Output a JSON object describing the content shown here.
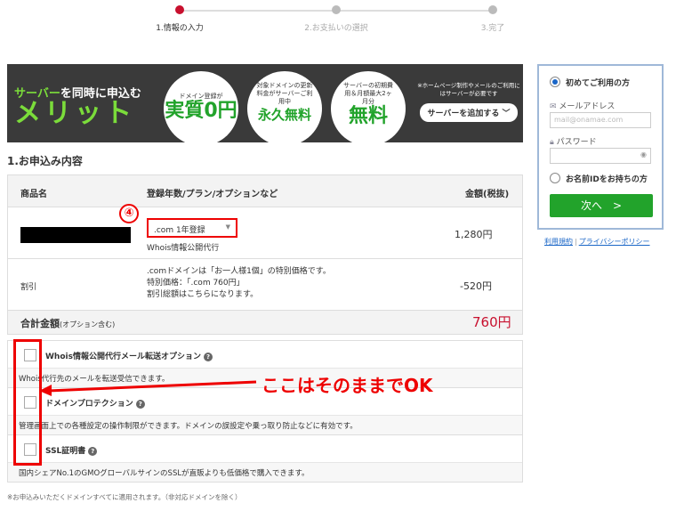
{
  "steps": [
    {
      "label": "1.情報の入力",
      "active": true
    },
    {
      "label": "2.お支払いの選択",
      "active": false
    },
    {
      "label": "3.完了",
      "active": false
    }
  ],
  "banner": {
    "line1_a": "サーバー",
    "line1_b": "を同時に申込む",
    "line2": "メリット",
    "circle1": {
      "small": "ドメイン登録が",
      "big": "実質0円"
    },
    "circle2": {
      "small": "対象ドメインの更新料金がサーバーご利用中",
      "big": "永久無料"
    },
    "circle3": {
      "small": "サーバーの初期費用＆月額最大2ヶ月分",
      "big": "無料"
    },
    "note": "※ホームページ制作やメールのご利用にはサーバーが必要です",
    "button": "サーバーを追加する"
  },
  "section_title": "1.お申込み内容",
  "order": {
    "headers": {
      "product": "商品名",
      "plan": "登録年数/プラン/オプションなど",
      "amount": "金額(税抜)"
    },
    "item": {
      "select_value": ".com 1年登録",
      "sub": "Whois情報公開代行",
      "price": "1,280円"
    },
    "discount": {
      "label": "割引",
      "lines": [
        ".comドメインは「お一人様1個」の特別価格です。",
        "特別価格：「.com 760円」",
        "割引総額はこちらになります。"
      ],
      "price": "-520円"
    },
    "total": {
      "label": "合計金額",
      "note": "(オプション含む)",
      "price": "760円"
    }
  },
  "annotation_number": "④",
  "options": [
    {
      "name": "Whois情報公開代行メール転送オプション",
      "desc": "Whois代行先のメールを転送受信できます。"
    },
    {
      "name": "ドメインプロテクション",
      "desc": "管理画面上での各種設定の操作制限ができます。ドメインの誤設定や乗っ取り防止などに有効です。"
    },
    {
      "name": "SSL証明書",
      "desc": "国内シェアNo.1のGMOグローバルサインのSSLが直販よりも低価格で購入できます。"
    }
  ],
  "annotation_text": "ここはそのままでOK",
  "footnote": "※お申込みいただくドメインすべてに適用されます。（非対応ドメインを除く）",
  "login": {
    "first_time": "初めてご利用の方",
    "email_label": "メールアドレス",
    "email_placeholder": "mail@onamae.com",
    "password_label": "パスワード",
    "has_id": "お名前IDをお持ちの方",
    "next_button": "次へ　>",
    "links": [
      "利用規約",
      "プライバシーポリシー"
    ]
  },
  "colors": {
    "accent": "#c8102e",
    "green": "#22a32b",
    "annotation": "#e00000"
  }
}
